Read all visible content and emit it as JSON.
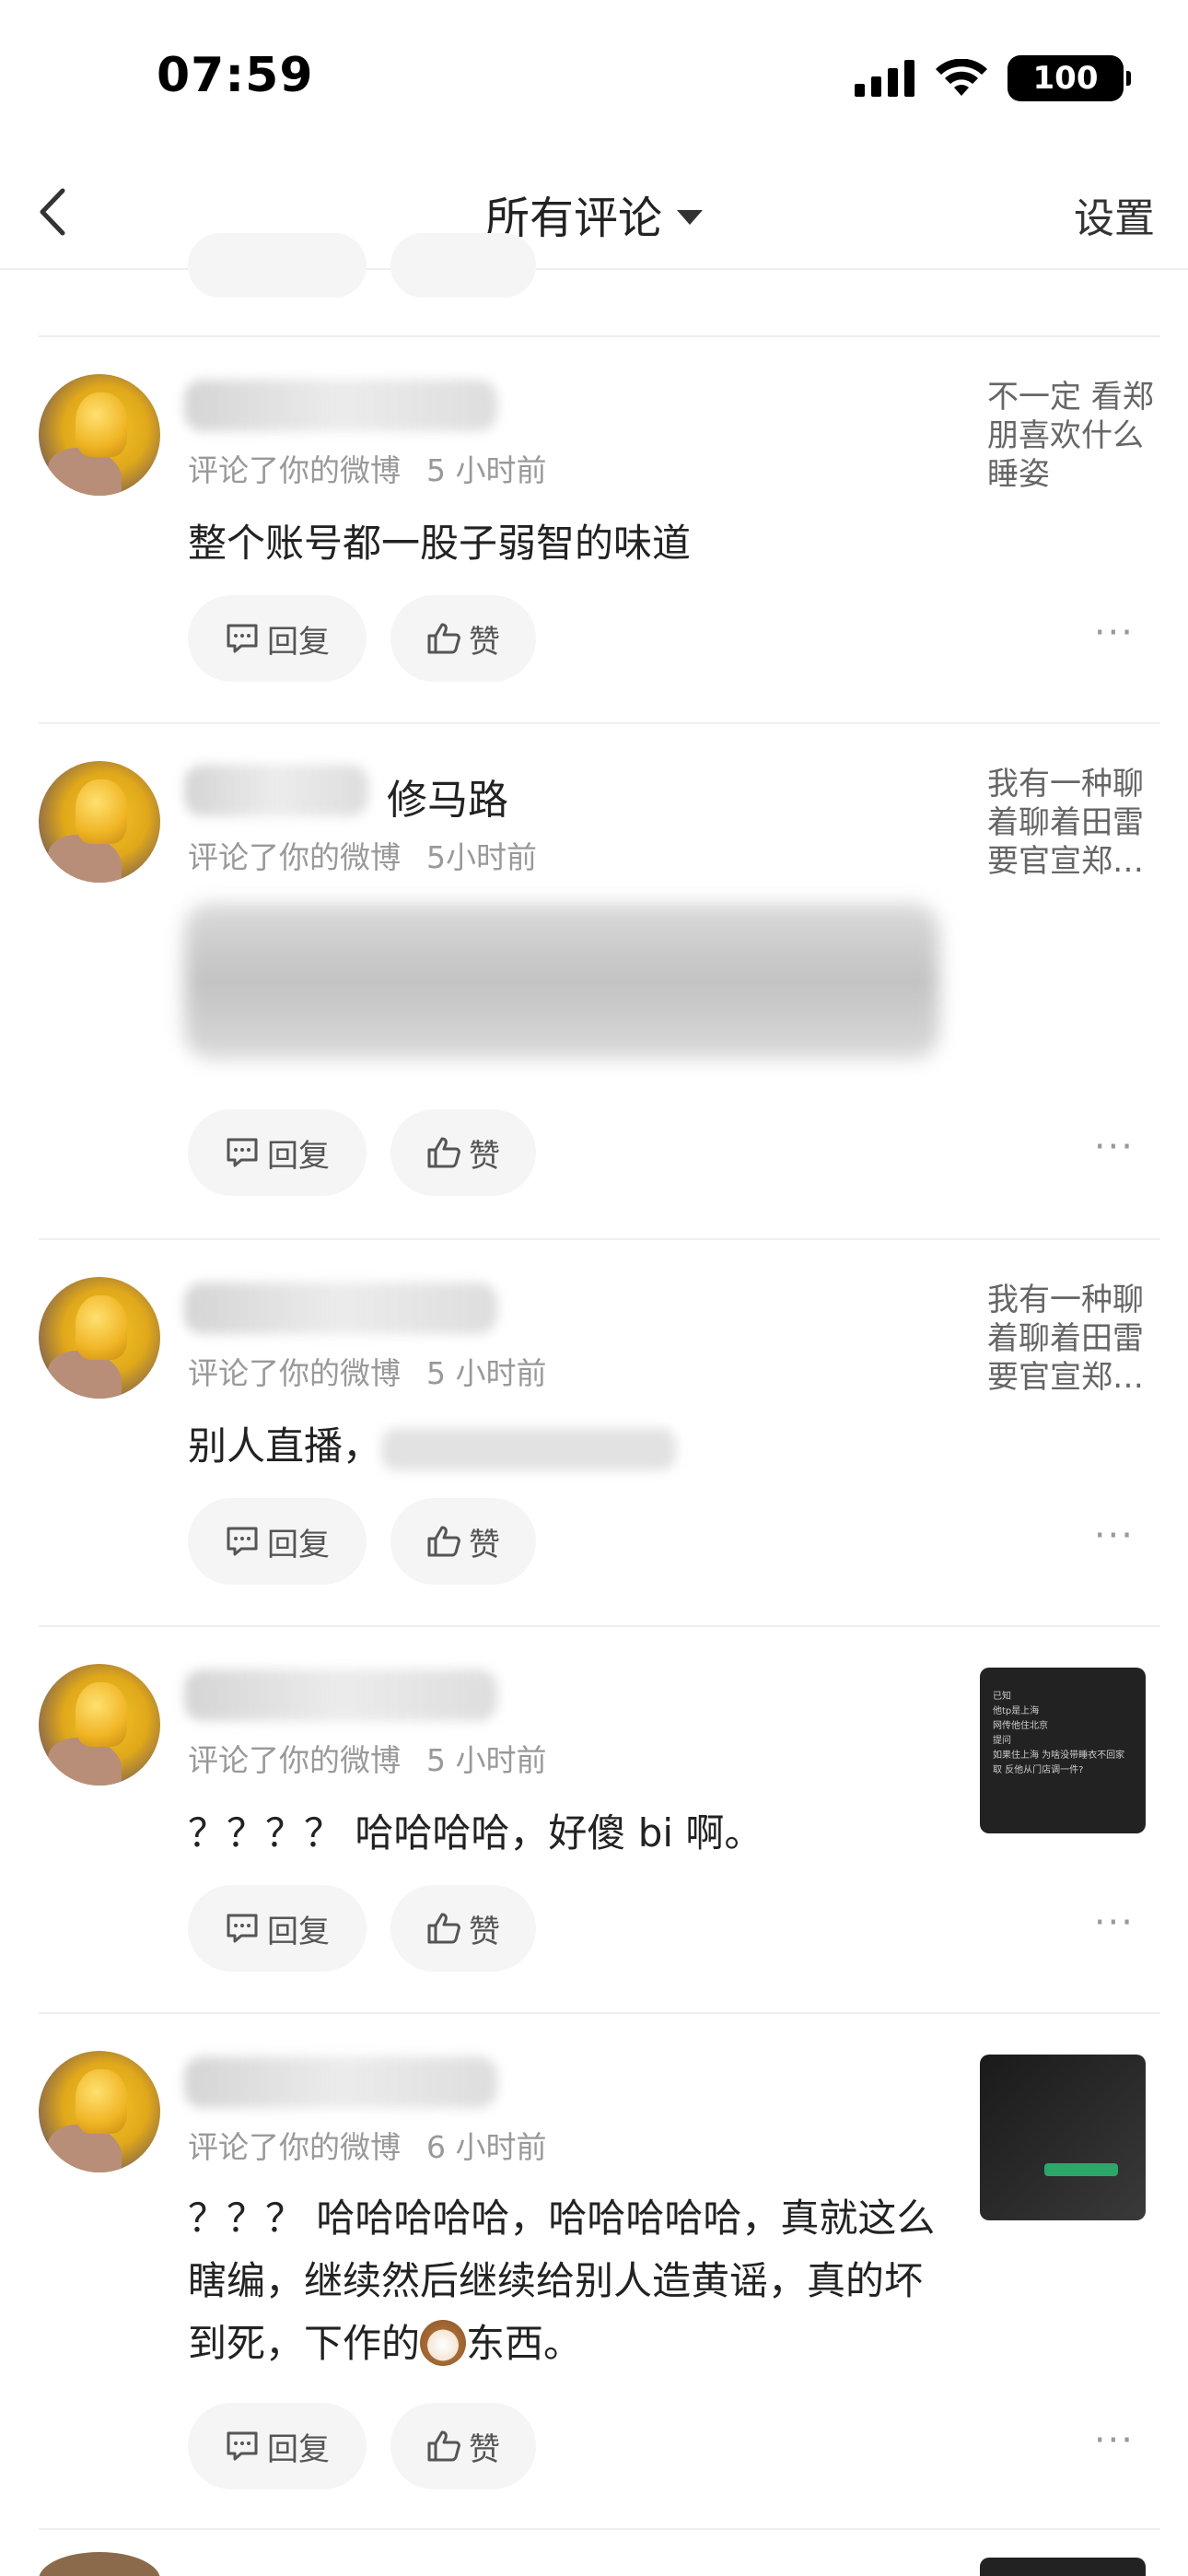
{
  "status_bar": {
    "time": "07:59",
    "battery": "100"
  },
  "nav": {
    "title": "所有评论",
    "settings": "设置"
  },
  "actions": {
    "reply": "回复",
    "like": "赞",
    "more": "···"
  },
  "comments": [
    {
      "meta_action": "评论了你的微博",
      "time": "5 小时前",
      "text": "整个账号都一股子弱智的味道",
      "right": "不一定 看郑朋喜欢什么睡姿"
    },
    {
      "username_visible": "修马路",
      "meta_action": "评论了你的微博",
      "time": "5小时前",
      "right": "我有一种聊着聊着田雷要官宣郑…"
    },
    {
      "meta_action": "评论了你的微博",
      "time": "5 小时前",
      "text": "别人直播，",
      "right": "我有一种聊着聊着田雷要官宣郑…"
    },
    {
      "meta_action": "评论了你的微博",
      "time": "5 小时前",
      "text": "？？？？ 哈哈哈哈，好傻 bi 啊。",
      "thumb_lines": [
        "已知",
        "他tp是上海",
        "网传他住北京",
        "提问",
        "如果住上海 为啥没带睡衣不回家",
        "取 反他从门店调一件?"
      ]
    },
    {
      "meta_action": "评论了你的微博",
      "time": "6 小时前",
      "text": "？？？ 哈哈哈哈哈，哈哈哈哈哈，真就这么瞎编，继续然后继续给别人造黄谣，真的坏到死，下作的",
      "text_after": "东西。"
    }
  ]
}
